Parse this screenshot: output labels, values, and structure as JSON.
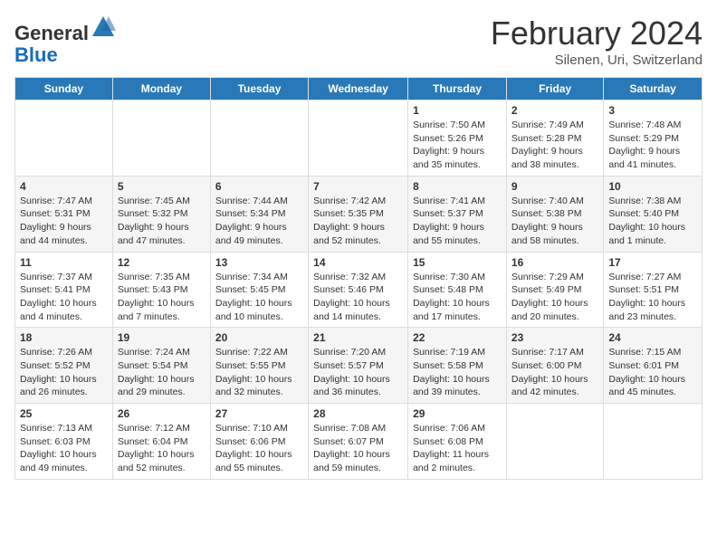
{
  "header": {
    "logo_general": "General",
    "logo_blue": "Blue",
    "month_title": "February 2024",
    "subtitle": "Silenen, Uri, Switzerland"
  },
  "days_of_week": [
    "Sunday",
    "Monday",
    "Tuesday",
    "Wednesday",
    "Thursday",
    "Friday",
    "Saturday"
  ],
  "weeks": [
    [
      {
        "day": "",
        "info": ""
      },
      {
        "day": "",
        "info": ""
      },
      {
        "day": "",
        "info": ""
      },
      {
        "day": "",
        "info": ""
      },
      {
        "day": "1",
        "info": "Sunrise: 7:50 AM\nSunset: 5:26 PM\nDaylight: 9 hours\nand 35 minutes."
      },
      {
        "day": "2",
        "info": "Sunrise: 7:49 AM\nSunset: 5:28 PM\nDaylight: 9 hours\nand 38 minutes."
      },
      {
        "day": "3",
        "info": "Sunrise: 7:48 AM\nSunset: 5:29 PM\nDaylight: 9 hours\nand 41 minutes."
      }
    ],
    [
      {
        "day": "4",
        "info": "Sunrise: 7:47 AM\nSunset: 5:31 PM\nDaylight: 9 hours\nand 44 minutes."
      },
      {
        "day": "5",
        "info": "Sunrise: 7:45 AM\nSunset: 5:32 PM\nDaylight: 9 hours\nand 47 minutes."
      },
      {
        "day": "6",
        "info": "Sunrise: 7:44 AM\nSunset: 5:34 PM\nDaylight: 9 hours\nand 49 minutes."
      },
      {
        "day": "7",
        "info": "Sunrise: 7:42 AM\nSunset: 5:35 PM\nDaylight: 9 hours\nand 52 minutes."
      },
      {
        "day": "8",
        "info": "Sunrise: 7:41 AM\nSunset: 5:37 PM\nDaylight: 9 hours\nand 55 minutes."
      },
      {
        "day": "9",
        "info": "Sunrise: 7:40 AM\nSunset: 5:38 PM\nDaylight: 9 hours\nand 58 minutes."
      },
      {
        "day": "10",
        "info": "Sunrise: 7:38 AM\nSunset: 5:40 PM\nDaylight: 10 hours\nand 1 minute."
      }
    ],
    [
      {
        "day": "11",
        "info": "Sunrise: 7:37 AM\nSunset: 5:41 PM\nDaylight: 10 hours\nand 4 minutes."
      },
      {
        "day": "12",
        "info": "Sunrise: 7:35 AM\nSunset: 5:43 PM\nDaylight: 10 hours\nand 7 minutes."
      },
      {
        "day": "13",
        "info": "Sunrise: 7:34 AM\nSunset: 5:45 PM\nDaylight: 10 hours\nand 10 minutes."
      },
      {
        "day": "14",
        "info": "Sunrise: 7:32 AM\nSunset: 5:46 PM\nDaylight: 10 hours\nand 14 minutes."
      },
      {
        "day": "15",
        "info": "Sunrise: 7:30 AM\nSunset: 5:48 PM\nDaylight: 10 hours\nand 17 minutes."
      },
      {
        "day": "16",
        "info": "Sunrise: 7:29 AM\nSunset: 5:49 PM\nDaylight: 10 hours\nand 20 minutes."
      },
      {
        "day": "17",
        "info": "Sunrise: 7:27 AM\nSunset: 5:51 PM\nDaylight: 10 hours\nand 23 minutes."
      }
    ],
    [
      {
        "day": "18",
        "info": "Sunrise: 7:26 AM\nSunset: 5:52 PM\nDaylight: 10 hours\nand 26 minutes."
      },
      {
        "day": "19",
        "info": "Sunrise: 7:24 AM\nSunset: 5:54 PM\nDaylight: 10 hours\nand 29 minutes."
      },
      {
        "day": "20",
        "info": "Sunrise: 7:22 AM\nSunset: 5:55 PM\nDaylight: 10 hours\nand 32 minutes."
      },
      {
        "day": "21",
        "info": "Sunrise: 7:20 AM\nSunset: 5:57 PM\nDaylight: 10 hours\nand 36 minutes."
      },
      {
        "day": "22",
        "info": "Sunrise: 7:19 AM\nSunset: 5:58 PM\nDaylight: 10 hours\nand 39 minutes."
      },
      {
        "day": "23",
        "info": "Sunrise: 7:17 AM\nSunset: 6:00 PM\nDaylight: 10 hours\nand 42 minutes."
      },
      {
        "day": "24",
        "info": "Sunrise: 7:15 AM\nSunset: 6:01 PM\nDaylight: 10 hours\nand 45 minutes."
      }
    ],
    [
      {
        "day": "25",
        "info": "Sunrise: 7:13 AM\nSunset: 6:03 PM\nDaylight: 10 hours\nand 49 minutes."
      },
      {
        "day": "26",
        "info": "Sunrise: 7:12 AM\nSunset: 6:04 PM\nDaylight: 10 hours\nand 52 minutes."
      },
      {
        "day": "27",
        "info": "Sunrise: 7:10 AM\nSunset: 6:06 PM\nDaylight: 10 hours\nand 55 minutes."
      },
      {
        "day": "28",
        "info": "Sunrise: 7:08 AM\nSunset: 6:07 PM\nDaylight: 10 hours\nand 59 minutes."
      },
      {
        "day": "29",
        "info": "Sunrise: 7:06 AM\nSunset: 6:08 PM\nDaylight: 11 hours\nand 2 minutes."
      },
      {
        "day": "",
        "info": ""
      },
      {
        "day": "",
        "info": ""
      }
    ]
  ]
}
